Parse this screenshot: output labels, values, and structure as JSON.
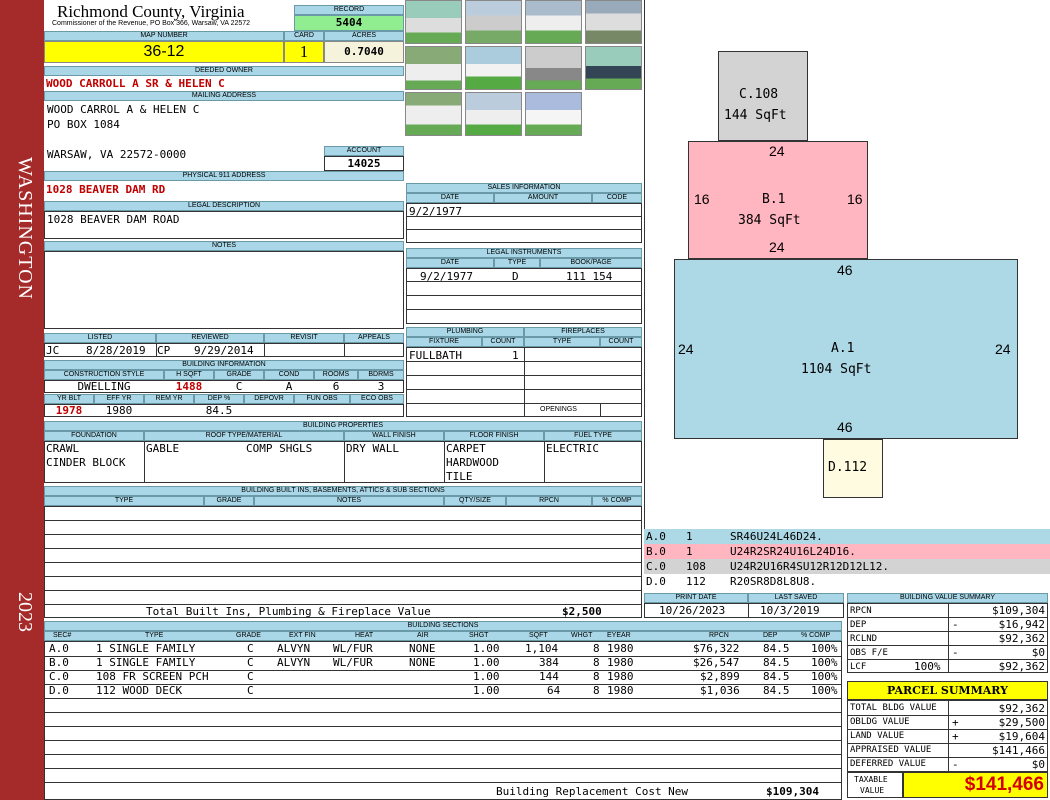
{
  "sidebar": {
    "district": "WASHINGTON",
    "year": "2023"
  },
  "header": {
    "county": "Richmond County, Virginia",
    "commissioner": "Commissioner of the Revenue, PO Box 366, Warsaw, VA 22572",
    "record_label": "RECORD",
    "record": "5404",
    "map_label": "MAP NUMBER",
    "map_number": "36-12",
    "card_label": "CARD",
    "card": "1",
    "acres_label": "ACRES",
    "acres": "0.7040"
  },
  "owner": {
    "deeded_label": "DEEDED OWNER",
    "deeded": "WOOD CARROLL A SR & HELEN C",
    "mailing_label": "MAILING ADDRESS",
    "mail1": "WOOD CARROL A & HELEN C",
    "mail2": "PO BOX 1084",
    "mail3": "WARSAW, VA 22572-0000",
    "account_label": "ACCOUNT",
    "account": "14025",
    "physical_label": "PHYSICAL 911 ADDRESS",
    "physical": "1028 BEAVER DAM RD",
    "legal_label": "LEGAL DESCRIPTION",
    "legal": "1028 BEAVER DAM ROAD",
    "notes_label": "NOTES"
  },
  "sales": {
    "title": "SALES INFORMATION",
    "h_date": "DATE",
    "h_amount": "AMOUNT",
    "h_code": "CODE",
    "date": "9/2/1977"
  },
  "legal_inst": {
    "title": "LEGAL INSTRUMENTS",
    "h_date": "DATE",
    "h_type": "TYPE",
    "h_book": "BOOK/PAGE",
    "date": "9/2/1977",
    "type": "D",
    "book": "111 154"
  },
  "plumbing": {
    "title": "PLUMBING",
    "h_fixture": "FIXTURE",
    "h_count": "COUNT",
    "fixture": "FULLBATH",
    "count": "1"
  },
  "fireplaces": {
    "title": "FIREPLACES",
    "h_type": "TYPE",
    "h_count": "COUNT",
    "openings": "OPENINGS"
  },
  "review": {
    "h_listed": "LISTED",
    "h_reviewed": "REVIEWED",
    "h_revisit": "REVISIT",
    "h_appeals": "APPEALS",
    "listed_by": "JC",
    "listed": "8/28/2019",
    "reviewed_by": "CP",
    "reviewed": "9/29/2014"
  },
  "building_info": {
    "title": "BUILDING INFORMATION",
    "h_style": "CONSTRUCTION STYLE",
    "h_hsqft": "H SQFT",
    "h_grade": "GRADE",
    "h_cond": "COND",
    "h_rooms": "ROOMS",
    "h_bdrms": "BDRMS",
    "style": "DWELLING",
    "hsqft": "1488",
    "grade": "C",
    "cond": "A",
    "rooms": "6",
    "bdrms": "3",
    "h_yrblt": "YR BLT",
    "h_effyr": "EFF YR",
    "h_remyr": "REM YR",
    "h_dep": "DEP %",
    "h_depovr": "DEPOVR",
    "h_funobs": "FUN OBS",
    "h_ecoobs": "ECO OBS",
    "yrblt": "1978",
    "effyr": "1980",
    "dep": "84.5"
  },
  "properties": {
    "title": "BUILDING PROPERTIES",
    "h_foundation": "FOUNDATION",
    "h_roof": "ROOF TYPE/MATERIAL",
    "h_wall": "WALL FINISH",
    "h_floor": "FLOOR FINISH",
    "h_fuel": "FUEL TYPE",
    "foundation1": "CRAWL",
    "foundation2": "CINDER BLOCK",
    "roof_type": "GABLE",
    "roof_mat": "COMP SHGLS",
    "wall": "DRY WALL",
    "floor1": "CARPET",
    "floor2": "HARDWOOD",
    "floor3": "TILE",
    "fuel": "ELECTRIC"
  },
  "builtins": {
    "title": "BUILDING BUILT INS, BASEMENTS, ATTICS & SUB SECTIONS",
    "h_type": "TYPE",
    "h_grade": "GRADE",
    "h_notes": "NOTES",
    "h_qty": "QTY/SIZE",
    "h_rpcn": "RPCN",
    "h_comp": "% COMP",
    "total_label": "Total Built Ins, Plumbing & Fireplace Value",
    "total": "$2,500"
  },
  "print": {
    "h_print": "PRINT DATE",
    "h_saved": "LAST SAVED",
    "print_date": "10/26/2023",
    "last_saved": "10/3/2019"
  },
  "sections": {
    "title": "BUILDING SECTIONS",
    "headers": [
      "SEC#",
      "TYPE",
      "GRADE",
      "EXT FIN",
      "HEAT",
      "AIR",
      "SHGT",
      "SQFT",
      "WHGT",
      "EYEAR",
      "RPCN",
      "DEP",
      "% COMP"
    ],
    "rows": [
      [
        "A.0",
        "1 SINGLE FAMILY",
        "C",
        "ALVYN",
        "WL/FUR",
        "NONE",
        "1.00",
        "1,104",
        "8",
        "1980",
        "$76,322",
        "84.5",
        "100%"
      ],
      [
        "B.0",
        "1 SINGLE FAMILY",
        "C",
        "ALVYN",
        "WL/FUR",
        "NONE",
        "1.00",
        "384",
        "8",
        "1980",
        "$26,547",
        "84.5",
        "100%"
      ],
      [
        "C.0",
        "108 FR SCREEN PCH",
        "C",
        "",
        "",
        "",
        "1.00",
        "144",
        "8",
        "1980",
        "$2,899",
        "84.5",
        "100%"
      ],
      [
        "D.0",
        "112 WOOD DECK",
        "C",
        "",
        "",
        "",
        "1.00",
        "64",
        "8",
        "1980",
        "$1,036",
        "84.5",
        "100%"
      ]
    ],
    "replacement_label": "Building Replacement Cost New",
    "replacement": "$109,304"
  },
  "sketch": {
    "c_label": "C.108",
    "c_area": "144 SqFt",
    "b_label": "B.1",
    "b_area": "384 SqFt",
    "a_label": "A.1",
    "a_area": "1104 SqFt",
    "d_label": "D.112",
    "b_top": "24",
    "b_left": "16",
    "b_right": "16",
    "b_bottom": "24",
    "a_top": "46",
    "a_left": "24",
    "a_right": "24",
    "a_bottom": "46",
    "colors": {
      "a": "#add8e6",
      "b": "#ffb6c1",
      "c": "#d3d3d3",
      "d": "#fffbe0"
    }
  },
  "sketch_legend": [
    {
      "sec": "A.0",
      "code": "1",
      "path": "SR46U24L46D24.",
      "color": "#add8e6"
    },
    {
      "sec": "B.0",
      "code": "1",
      "path": "U24R2SR24U16L24D16.",
      "color": "#ffb6c1"
    },
    {
      "sec": "C.0",
      "code": "108",
      "path": "U24R2U16R4SU12R12D12L12.",
      "color": "#d3d3d3"
    },
    {
      "sec": "D.0",
      "code": "112",
      "path": "R20SR8D8L8U8.",
      "color": "#ffffff"
    }
  ],
  "value_summary": {
    "title": "BUILDING VALUE SUMMARY",
    "rpcn_label": "RPCN",
    "rpcn": "$109,304",
    "dep_label": "DEP",
    "dep_sign": "-",
    "dep": "$16,942",
    "rclnd_label": "RCLND",
    "rclnd": "$92,362",
    "obs_label": "OBS F/E",
    "obs_sign": "-",
    "obs": "$0",
    "lcf_label": "LCF",
    "lcf_pct": "100%",
    "lcf": "$92,362"
  },
  "parcel": {
    "title": "PARCEL SUMMARY",
    "bldg_label": "TOTAL BLDG VALUE",
    "bldg": "$92,362",
    "obldg_label": "OBLDG VALUE",
    "obldg_sign": "+",
    "obldg": "$29,500",
    "land_label": "LAND VALUE",
    "land_sign": "+",
    "land": "$19,604",
    "appraised_label": "APPRAISED VALUE",
    "appraised": "$141,466",
    "deferred_label": "DEFERRED VALUE",
    "deferred_sign": "-",
    "deferred": "$0",
    "taxable_label1": "TAXABLE",
    "taxable_label2": "VALUE",
    "taxable": "$141,466"
  }
}
